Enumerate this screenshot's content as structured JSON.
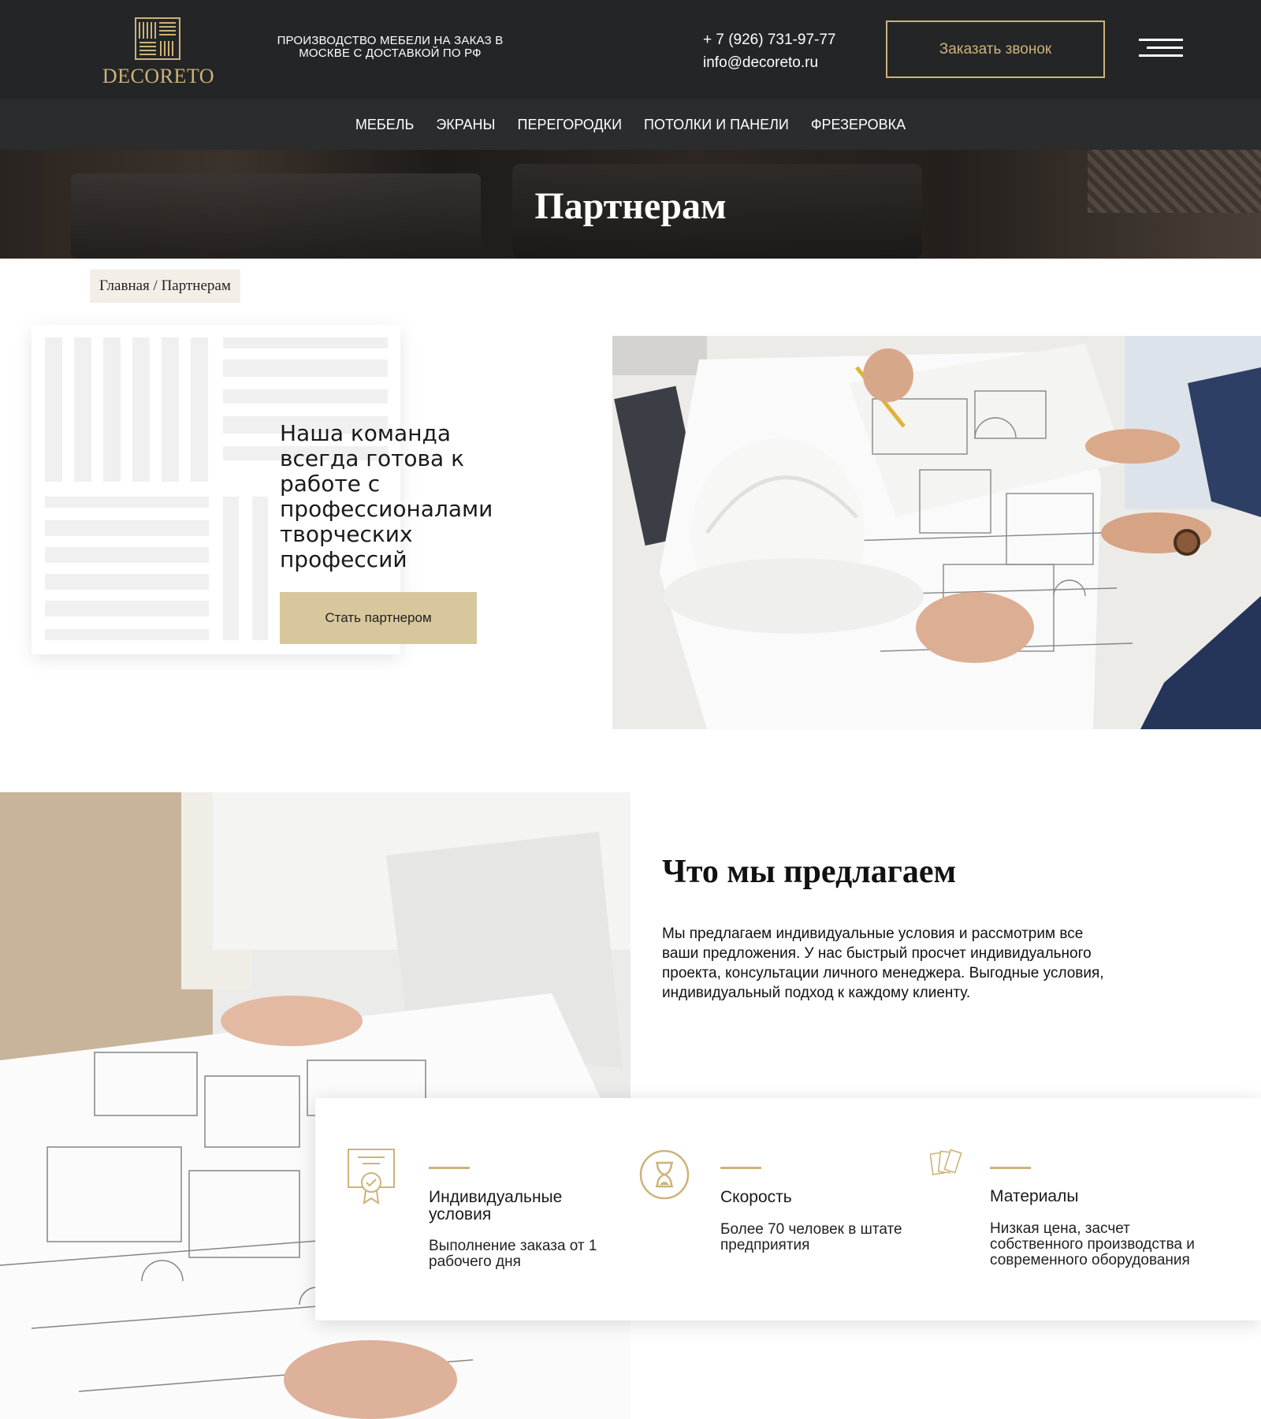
{
  "header": {
    "logo_text": "DECORETO",
    "tagline": "ПРОИЗВОДСТВО МЕБЕЛИ НА ЗАКАЗ В МОСКВЕ С ДОСТАВКОЙ ПО РФ",
    "phone": "+ 7 (926) 731-97-77",
    "email": "info@decoreto.ru",
    "callback_label": "Заказать звонок",
    "menu_icon": "hamburger-icon"
  },
  "nav": {
    "items": [
      {
        "label": "МЕБЕЛЬ"
      },
      {
        "label": "ЭКРАНЫ"
      },
      {
        "label": "ПЕРЕГОРОДКИ"
      },
      {
        "label": "ПОТОЛКИ И ПАНЕЛИ"
      },
      {
        "label": "ФРЕЗЕРОВКА"
      }
    ]
  },
  "hero": {
    "title": "Партнерам"
  },
  "breadcrumb": {
    "home": "Главная",
    "separator": "/",
    "current": "Партнерам"
  },
  "partner": {
    "text": "Наша команда всегда готова к работе с профессионалами творческих профессий",
    "button_label": "Стать партнером"
  },
  "offer": {
    "title": "Что мы предлагаем",
    "text": "Мы предлагаем индивидуальные условия и рассмотрим все ваши предложения. У нас быстрый просчет индивидуального проекта, консультации личного менеджера. Выгодные условия, индивидуальный подход к каждому клиенту."
  },
  "features": [
    {
      "icon": "certificate-icon",
      "title": "Индивидуальные условия",
      "text": "Выполнение заказа от 1 рабочего дня"
    },
    {
      "icon": "hourglass-icon",
      "title": "Скорость",
      "text": "Более 70 человек в штате предприятия"
    },
    {
      "icon": "material-samples-icon",
      "title": "Материалы",
      "text": "Низкая цена, засчет собственного производства и современного оборудования"
    }
  ],
  "colors": {
    "header_bg": "#242526",
    "nav_bg": "#2b2c2d",
    "accent_gold": "#cdb37b",
    "button_gold": "#d8c79c"
  }
}
